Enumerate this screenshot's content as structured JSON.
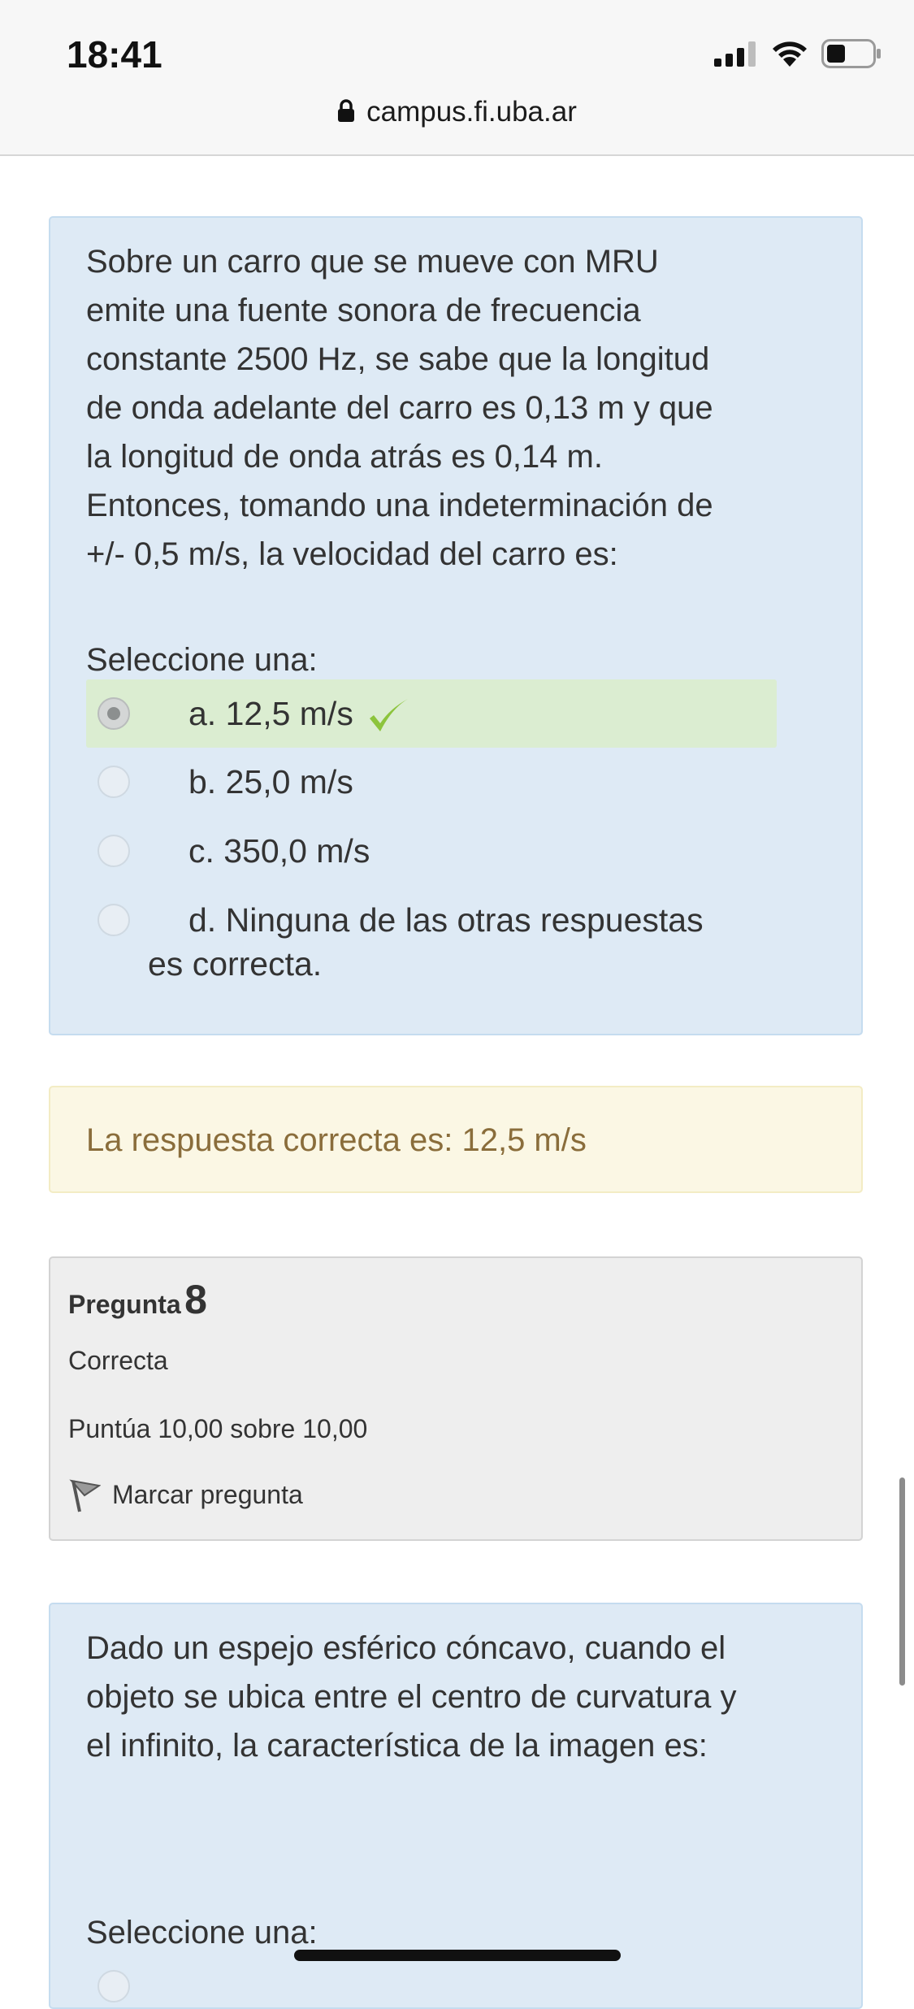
{
  "status_bar": {
    "time": "18:41"
  },
  "browser": {
    "url": "campus.fi.uba.ar"
  },
  "question7": {
    "text_lines": [
      "Sobre un carro que se mueve con MRU",
      "emite una fuente sonora de frecuencia",
      "constante 2500 Hz, se sabe que la longitud",
      "de onda adelante del carro es 0,13 m y que",
      "la longitud de onda atrás es 0,14 m.",
      "Entonces, tomando una indeterminación de",
      "+/- 0,5 m/s, la velocidad del carro es:"
    ],
    "select_label": "Seleccione una:",
    "options": [
      {
        "label": "a. 12,5 m/s",
        "selected": true,
        "correct": true
      },
      {
        "label": "b. 25,0 m/s"
      },
      {
        "label": "c. 350,0 m/s"
      },
      {
        "label": "d. Ninguna de las otras respuestas",
        "label_line2": "es correcta."
      }
    ],
    "feedback": "La respuesta correcta es: 12,5 m/s"
  },
  "question8": {
    "prefix": "Pregunta",
    "number": "8",
    "state": "Correcta",
    "grade": "Puntúa 10,00 sobre 10,00",
    "flag_label": "Marcar pregunta",
    "text_lines": [
      "Dado un espejo esférico cóncavo, cuando el",
      "objeto se ubica entre el centro de curvatura y",
      "el infinito, la característica de la imagen es:"
    ],
    "select_label": "Seleccione una:"
  },
  "colors": {
    "question_bg": "#deeaf5",
    "correct_option_bg": "#dbedd1",
    "check_green": "#8cc43c",
    "feedback_bg": "#fbf7e4",
    "feedback_text": "#8a6d3b",
    "info_bg": "#eeeeee"
  }
}
